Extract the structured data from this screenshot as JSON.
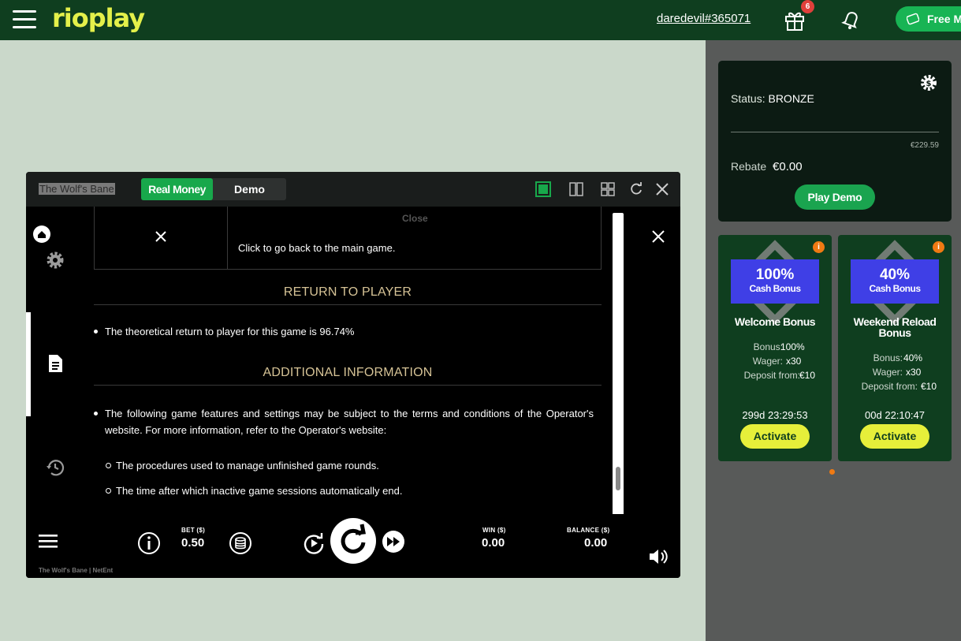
{
  "header": {
    "logo": "rioplay",
    "username": "daredevil#365071",
    "gift_count": "6",
    "free_button": "Free M"
  },
  "status_card": {
    "status_label": "Status:",
    "status_value": "BRONZE",
    "progress_value": "€229.59",
    "rebate_label": "Rebate",
    "rebate_value": "€0.00",
    "play_demo": "Play Demo"
  },
  "bonuses": [
    {
      "percent": "100%",
      "subtitle": "Cash Bonus",
      "title": "Welcome Bonus",
      "bonus_label": "Bonus:",
      "bonus_value": "100%",
      "wager_label": "Wager:",
      "wager_value": "x30",
      "deposit_label": "Deposit from:",
      "deposit_value": "€10",
      "timer": "299d  23:29:53",
      "cta": "Activate",
      "info": "i"
    },
    {
      "percent": "40%",
      "subtitle": "Cash Bonus",
      "title": "Weekend Reload Bonus",
      "bonus_label": "Bonus:",
      "bonus_value": "40%",
      "wager_label": "Wager:",
      "wager_value": "x30",
      "deposit_label": "Deposit from:",
      "deposit_value": "€10",
      "timer": "00d  22:10:47",
      "cta": "Activate",
      "info": "i"
    }
  ],
  "game": {
    "title": "The Wolf's Bane",
    "mode_real": "Real Money",
    "mode_demo": "Demo",
    "close_header": "Close",
    "close_desc": "Click to go back to the main game.",
    "section_rtp": "RETURN TO PLAYER",
    "rtp_text": "The theoretical return to player for this game is 96.74%",
    "section_additional": "ADDITIONAL INFORMATION",
    "additional_text": "The following game features and settings may be subject to the terms and conditions of the Operator's website. For more information, refer to the Operator's website:",
    "sub_items": [
      "The procedures used to manage unfinished game rounds.",
      "The time after which inactive game sessions automatically end."
    ],
    "bet_label": "BET ($)",
    "bet_value": "0.50",
    "win_label": "WIN ($)",
    "win_value": "0.00",
    "balance_label": "BALANCE ($)",
    "balance_value": "0.00",
    "footer": "The Wolf's Bane  |  NetEnt"
  },
  "colors": {
    "header_bg": "#0f3e1f",
    "accent_green": "#18a84b",
    "accent_yellow": "#e6ef3a",
    "bonus_blue": "#3f3fe6",
    "section_gold": "#d6c396"
  },
  "icons": [
    "menu-icon",
    "gift-icon",
    "bell-icon",
    "settings-icon",
    "home-icon",
    "gear-icon",
    "document-icon",
    "history-icon",
    "info-icon",
    "coins-icon",
    "autoplay-icon",
    "spin-icon",
    "fast-forward-icon",
    "volume-icon"
  ]
}
